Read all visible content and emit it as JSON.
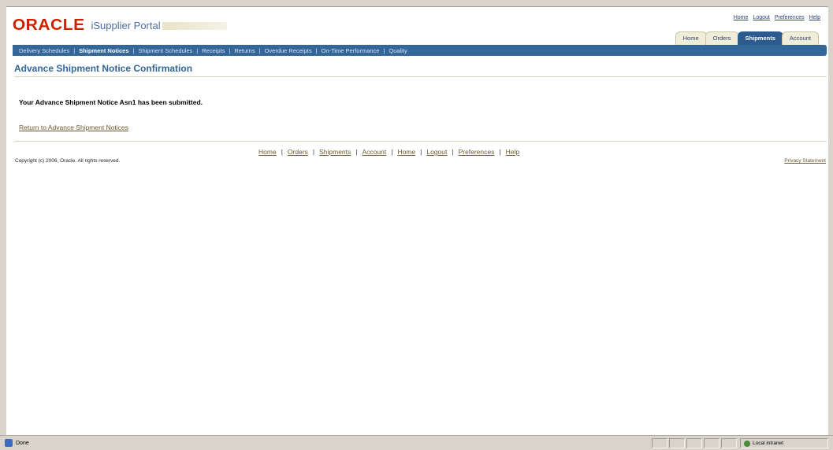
{
  "brand": {
    "logo": "ORACLE",
    "product": "iSupplier Portal"
  },
  "global_links": [
    "Home",
    "Logout",
    "Preferences",
    "Help"
  ],
  "tabs": [
    {
      "label": "Home",
      "active": false
    },
    {
      "label": "Orders",
      "active": false
    },
    {
      "label": "Shipments",
      "active": true
    },
    {
      "label": "Account",
      "active": false
    }
  ],
  "subnav": [
    {
      "label": "Delivery Schedules",
      "active": false
    },
    {
      "label": "Shipment Notices",
      "active": true
    },
    {
      "label": "Shipment Schedules",
      "active": false
    },
    {
      "label": "Receipts",
      "active": false
    },
    {
      "label": "Returns",
      "active": false
    },
    {
      "label": "Overdue Receipts",
      "active": false
    },
    {
      "label": "On-Time Performance",
      "active": false
    },
    {
      "label": "Quality",
      "active": false
    }
  ],
  "page_title": "Advance Shipment Notice Confirmation",
  "message": "Your Advance Shipment Notice Asn1 has been submitted.",
  "return_link": "Return to Advance Shipment Notices",
  "footer": {
    "links": [
      "Home",
      "Orders",
      "Shipments",
      "Account",
      "Home",
      "Logout",
      "Preferences",
      "Help"
    ],
    "copyright": "Copyright (c) 2006, Oracle. All rights reserved.",
    "privacy": "Privacy Statement"
  },
  "statusbar": {
    "status": "Done",
    "zone": "Local intranet"
  },
  "colors": {
    "nav_blue": "#336699",
    "logo_red": "#cc2200",
    "link_brown": "#6b5a2e"
  }
}
